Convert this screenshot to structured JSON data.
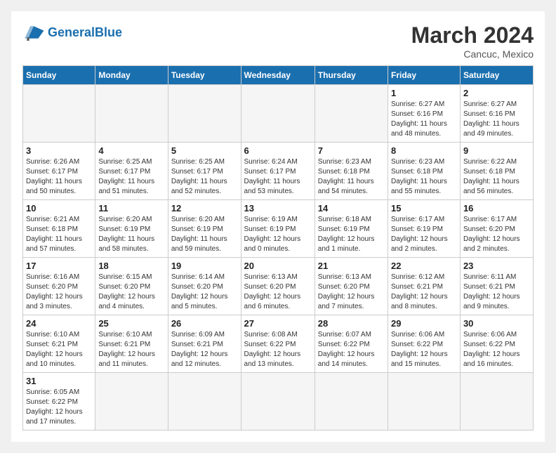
{
  "header": {
    "logo_general": "General",
    "logo_blue": "Blue",
    "month_title": "March 2024",
    "location": "Cancuc, Mexico"
  },
  "weekdays": [
    "Sunday",
    "Monday",
    "Tuesday",
    "Wednesday",
    "Thursday",
    "Friday",
    "Saturday"
  ],
  "weeks": [
    [
      {
        "day": "",
        "info": ""
      },
      {
        "day": "",
        "info": ""
      },
      {
        "day": "",
        "info": ""
      },
      {
        "day": "",
        "info": ""
      },
      {
        "day": "",
        "info": ""
      },
      {
        "day": "1",
        "info": "Sunrise: 6:27 AM\nSunset: 6:16 PM\nDaylight: 11 hours\nand 48 minutes."
      },
      {
        "day": "2",
        "info": "Sunrise: 6:27 AM\nSunset: 6:16 PM\nDaylight: 11 hours\nand 49 minutes."
      }
    ],
    [
      {
        "day": "3",
        "info": "Sunrise: 6:26 AM\nSunset: 6:17 PM\nDaylight: 11 hours\nand 50 minutes."
      },
      {
        "day": "4",
        "info": "Sunrise: 6:25 AM\nSunset: 6:17 PM\nDaylight: 11 hours\nand 51 minutes."
      },
      {
        "day": "5",
        "info": "Sunrise: 6:25 AM\nSunset: 6:17 PM\nDaylight: 11 hours\nand 52 minutes."
      },
      {
        "day": "6",
        "info": "Sunrise: 6:24 AM\nSunset: 6:17 PM\nDaylight: 11 hours\nand 53 minutes."
      },
      {
        "day": "7",
        "info": "Sunrise: 6:23 AM\nSunset: 6:18 PM\nDaylight: 11 hours\nand 54 minutes."
      },
      {
        "day": "8",
        "info": "Sunrise: 6:23 AM\nSunset: 6:18 PM\nDaylight: 11 hours\nand 55 minutes."
      },
      {
        "day": "9",
        "info": "Sunrise: 6:22 AM\nSunset: 6:18 PM\nDaylight: 11 hours\nand 56 minutes."
      }
    ],
    [
      {
        "day": "10",
        "info": "Sunrise: 6:21 AM\nSunset: 6:18 PM\nDaylight: 11 hours\nand 57 minutes."
      },
      {
        "day": "11",
        "info": "Sunrise: 6:20 AM\nSunset: 6:19 PM\nDaylight: 11 hours\nand 58 minutes."
      },
      {
        "day": "12",
        "info": "Sunrise: 6:20 AM\nSunset: 6:19 PM\nDaylight: 11 hours\nand 59 minutes."
      },
      {
        "day": "13",
        "info": "Sunrise: 6:19 AM\nSunset: 6:19 PM\nDaylight: 12 hours\nand 0 minutes."
      },
      {
        "day": "14",
        "info": "Sunrise: 6:18 AM\nSunset: 6:19 PM\nDaylight: 12 hours\nand 1 minute."
      },
      {
        "day": "15",
        "info": "Sunrise: 6:17 AM\nSunset: 6:19 PM\nDaylight: 12 hours\nand 2 minutes."
      },
      {
        "day": "16",
        "info": "Sunrise: 6:17 AM\nSunset: 6:20 PM\nDaylight: 12 hours\nand 2 minutes."
      }
    ],
    [
      {
        "day": "17",
        "info": "Sunrise: 6:16 AM\nSunset: 6:20 PM\nDaylight: 12 hours\nand 3 minutes."
      },
      {
        "day": "18",
        "info": "Sunrise: 6:15 AM\nSunset: 6:20 PM\nDaylight: 12 hours\nand 4 minutes."
      },
      {
        "day": "19",
        "info": "Sunrise: 6:14 AM\nSunset: 6:20 PM\nDaylight: 12 hours\nand 5 minutes."
      },
      {
        "day": "20",
        "info": "Sunrise: 6:13 AM\nSunset: 6:20 PM\nDaylight: 12 hours\nand 6 minutes."
      },
      {
        "day": "21",
        "info": "Sunrise: 6:13 AM\nSunset: 6:20 PM\nDaylight: 12 hours\nand 7 minutes."
      },
      {
        "day": "22",
        "info": "Sunrise: 6:12 AM\nSunset: 6:21 PM\nDaylight: 12 hours\nand 8 minutes."
      },
      {
        "day": "23",
        "info": "Sunrise: 6:11 AM\nSunset: 6:21 PM\nDaylight: 12 hours\nand 9 minutes."
      }
    ],
    [
      {
        "day": "24",
        "info": "Sunrise: 6:10 AM\nSunset: 6:21 PM\nDaylight: 12 hours\nand 10 minutes."
      },
      {
        "day": "25",
        "info": "Sunrise: 6:10 AM\nSunset: 6:21 PM\nDaylight: 12 hours\nand 11 minutes."
      },
      {
        "day": "26",
        "info": "Sunrise: 6:09 AM\nSunset: 6:21 PM\nDaylight: 12 hours\nand 12 minutes."
      },
      {
        "day": "27",
        "info": "Sunrise: 6:08 AM\nSunset: 6:22 PM\nDaylight: 12 hours\nand 13 minutes."
      },
      {
        "day": "28",
        "info": "Sunrise: 6:07 AM\nSunset: 6:22 PM\nDaylight: 12 hours\nand 14 minutes."
      },
      {
        "day": "29",
        "info": "Sunrise: 6:06 AM\nSunset: 6:22 PM\nDaylight: 12 hours\nand 15 minutes."
      },
      {
        "day": "30",
        "info": "Sunrise: 6:06 AM\nSunset: 6:22 PM\nDaylight: 12 hours\nand 16 minutes."
      }
    ],
    [
      {
        "day": "31",
        "info": "Sunrise: 6:05 AM\nSunset: 6:22 PM\nDaylight: 12 hours\nand 17 minutes."
      },
      {
        "day": "",
        "info": ""
      },
      {
        "day": "",
        "info": ""
      },
      {
        "day": "",
        "info": ""
      },
      {
        "day": "",
        "info": ""
      },
      {
        "day": "",
        "info": ""
      },
      {
        "day": "",
        "info": ""
      }
    ]
  ]
}
